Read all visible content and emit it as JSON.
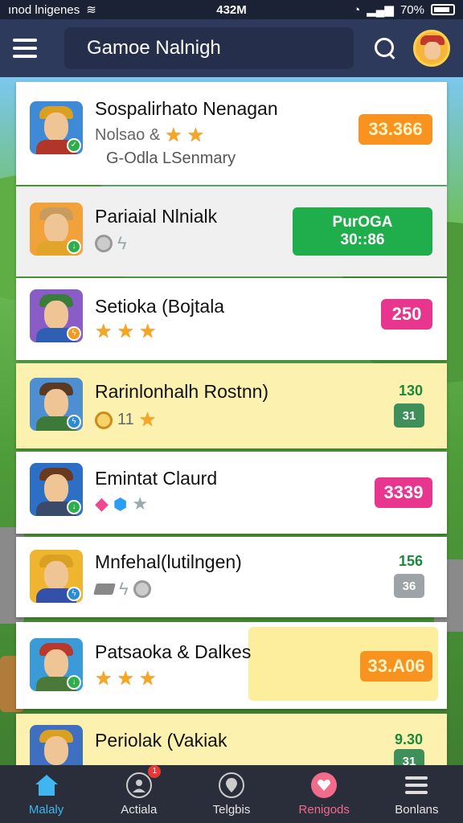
{
  "status_bar": {
    "carrier": "ınod lnigenes",
    "time": "432M",
    "battery": "70%"
  },
  "header": {
    "title": "Gamoe Nalnigh",
    "search_icon": "search-icon",
    "menu_icon": "hamburger-icon"
  },
  "rows": [
    {
      "name": "Sospalirhato Nenagan",
      "sub": "Nolsao &",
      "sub2": "G-Odla LSenmary",
      "stars": 2,
      "chip": "33.366",
      "chip_color": "#f7931e"
    },
    {
      "name": "Pariaial Nlnialk",
      "chip_line1": "PurOGA",
      "chip_line2": "30::86",
      "chip_color": "#1fae4b"
    },
    {
      "name": "Setioka (Bojtala",
      "stars": 3,
      "chip": "250",
      "chip_color": "#e8368f"
    },
    {
      "name": "Rarinlonhalh Rostnn)",
      "sub": "11",
      "score": "130",
      "mini": "31"
    },
    {
      "name": "Emintat Claurd",
      "chip": "3339",
      "chip_color": "#e8368f"
    },
    {
      "name": "Mnfehal(lutilngen)",
      "score": "156",
      "mini": "36"
    },
    {
      "name": "Patsaoka & Dalkes",
      "stars": 3,
      "chip": "33.A06",
      "chip_color": "#f7931e"
    },
    {
      "name": "Periolak (Vakiak",
      "score": "9.30",
      "mini": "31"
    }
  ],
  "bottom_nav": [
    {
      "label": "Malaly",
      "icon": "home-icon"
    },
    {
      "label": "Actiala",
      "icon": "friends-icon",
      "badge": "1"
    },
    {
      "label": "Telgbis",
      "icon": "location-icon"
    },
    {
      "label": "Renigods",
      "icon": "rewards-icon"
    },
    {
      "label": "Bonlans",
      "icon": "menu-icon"
    }
  ]
}
